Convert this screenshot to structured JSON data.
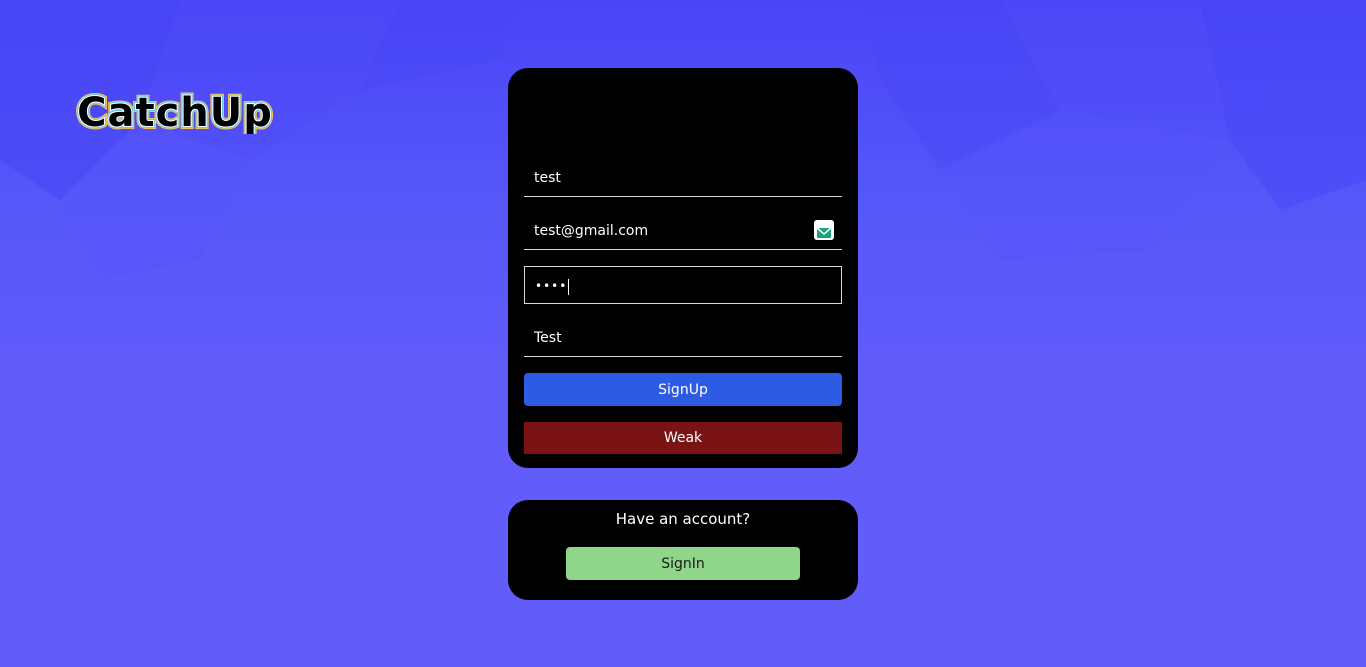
{
  "app": {
    "logo_text": "CatchUp"
  },
  "signup_form": {
    "username_value": "test",
    "email_value": "test@gmail.com",
    "password_value": "••••",
    "confirm_value": "Test",
    "signup_label": "SignUp",
    "strength_label": "Weak"
  },
  "signin_box": {
    "prompt": "Have an account?",
    "signin_label": "SignIn"
  },
  "icons": {
    "email_field_icon": "mail-icon"
  },
  "colors": {
    "background": "#5e59fa",
    "card": "#000000",
    "signup_button": "#2d5be3",
    "strength_weak": "#7a1414",
    "signin_button": "#8fd68a"
  }
}
